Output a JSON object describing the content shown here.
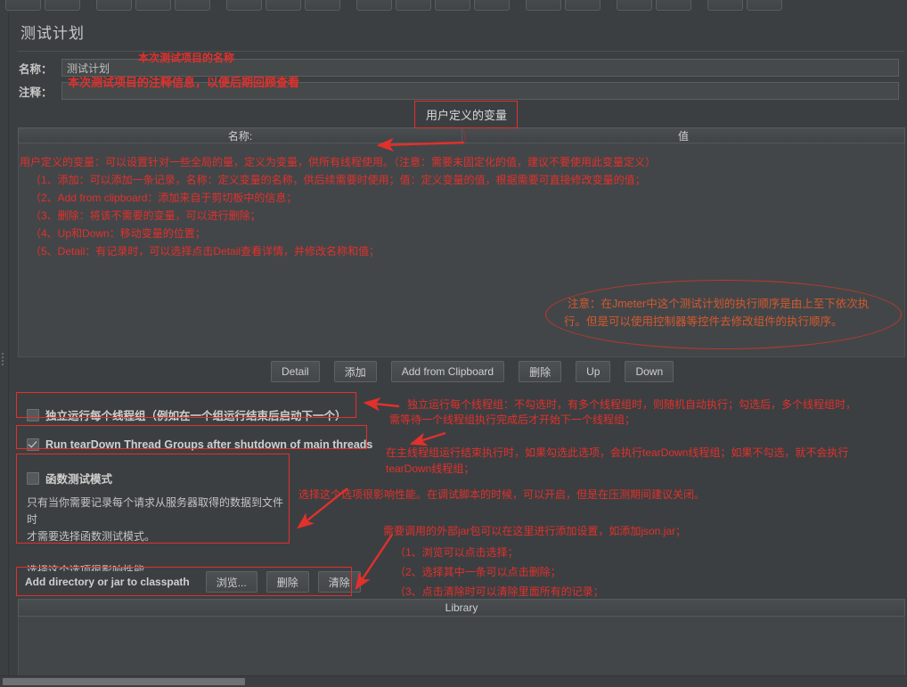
{
  "window": {
    "title": "测试计划",
    "toolbar_buttons": [
      "new",
      "open",
      "save",
      "cut",
      "copy",
      "paste",
      "expand",
      "collapse",
      "toggle",
      "start",
      "start-no-pause",
      "stop",
      "shutdown",
      "clear",
      "clear-all",
      "search",
      "reset-search",
      "function-helper",
      "help"
    ]
  },
  "fields": {
    "name_label": "名称：",
    "name_value": "测试计划",
    "comment_label": "注释：",
    "comment_value": ""
  },
  "user_defined_variables": {
    "callout": "用户定义的变量",
    "col_name": "名称:",
    "col_value": "值"
  },
  "buttons": {
    "detail": "Detail",
    "add": "添加",
    "add_from_clipboard": "Add from Clipboard",
    "delete": "删除",
    "up": "Up",
    "down": "Down"
  },
  "options": {
    "independent_groups": {
      "label": "独立运行每个线程组（例如在一个组运行结束后启动下一个）",
      "checked": false
    },
    "teardown": {
      "label": "Run tearDown Thread Groups after shutdown of main threads",
      "checked": true
    },
    "functional_mode": {
      "label": "函数测试模式",
      "checked": false,
      "desc_line1": "只有当你需要记录每个请求从服务器取得的数据到文件时",
      "desc_line2": "才需要选择函数测试模式。",
      "desc_line3": "选择这个选项很影响性能。"
    }
  },
  "classpath": {
    "label": "Add directory or jar to classpath",
    "browse": "浏览...",
    "delete": "删除",
    "clear": "清除",
    "library_header": "Library"
  },
  "annotations": {
    "name_note": "本次测试项目的名称",
    "comment_note": "本次测试项目的注释信息，以便后期回顾查看",
    "udv_lines": [
      "用户定义的变量：可以设置针对一些全局的量，定义为变量，供所有线程使用。（注意：需要未固定化的值，建议不要使用此变量定义）",
      "（1、添加：可以添加一条记录，名称：定义变量的名称，供后续需要时使用；值：定义变量的值，根据需要可直接修改变量的值；",
      "（2、Add from clipboard：添加来自于剪切板中的信息；",
      "（3、删除：将该不需要的变量，可以进行删除；",
      "（4、Up和Down：移动变量的位置；",
      "（5、Detail：有记录时，可以选择点击Detail查看详情，并修改名称和值；"
    ],
    "order_note_line1": "注意：在Jmeter中这个测试计划的执行顺序是由上至下依次执",
    "order_note_line2": "行。但是可以使用控制器等控件去修改组件的执行顺序。",
    "independent_note_line1": "独立运行每个线程组：不勾选时，有多个线程组时，则随机自动执行；勾选后，多个线程组时，",
    "independent_note_line2": "需等待一个线程组执行完成后才开始下一个线程组；",
    "teardown_note_line1": "在主线程组运行结束执行时，如果勾选此选项，会执行tearDown线程组；如果不勾选，就不会执行",
    "teardown_note_line2": "tearDown线程组；",
    "functional_note": "选择这个选项很影响性能。在调试脚本的时候，可以开启，但是在压测期间建议关闭。",
    "classpath_note_head": "需要调用的外部jar包可以在这里进行添加设置，如添加json.jar；",
    "classpath_note_lines": [
      "（1、浏览可以点击选择；",
      "（2、选择其中一条可以点击删除；",
      "（3、点击清除时可以清除里面所有的记录；"
    ]
  },
  "colors": {
    "bg": "#3c3f41",
    "panel": "#3c3f41",
    "annotation_red": "#e2302c",
    "text": "#c7c7c7",
    "field_bg": "#45494a"
  }
}
